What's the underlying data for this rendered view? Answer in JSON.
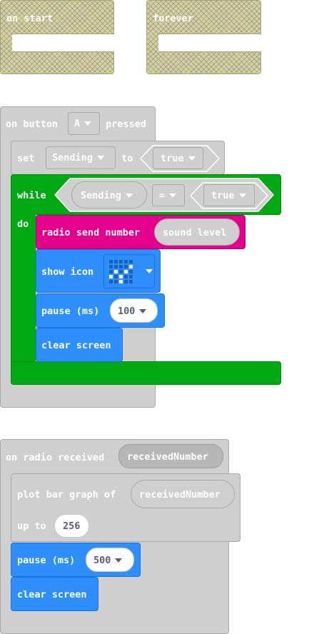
{
  "on_start": {
    "label": "on start"
  },
  "forever": {
    "label": "forever"
  },
  "button_event": {
    "prefix": "on button",
    "button": "A",
    "suffix": "pressed",
    "set": {
      "keyword": "set",
      "variable": "Sending",
      "to": "to",
      "value": "true"
    },
    "while": {
      "keyword": "while",
      "do": "do",
      "left": "Sending",
      "operator": "=",
      "right": "true"
    },
    "radio_send": {
      "label": "radio send number",
      "value": "sound level"
    },
    "show_icon": {
      "label": "show icon",
      "icon": "pixel-icon"
    },
    "pause": {
      "label": "pause (ms)",
      "value": "100"
    },
    "clear": {
      "label": "clear screen"
    }
  },
  "radio_event": {
    "label": "on radio received",
    "param": "receivedNumber",
    "plot": {
      "label": "plot bar graph of",
      "value": "receivedNumber",
      "upto_label": "up to",
      "upto_value": "256"
    },
    "pause": {
      "label": "pause (ms)",
      "value": "500"
    },
    "clear": {
      "label": "clear screen"
    }
  },
  "colors": {
    "event_gray": "#cfcfcf",
    "loops_green": "#00a811",
    "radio_pink": "#e3008c",
    "basic_blue": "#2e8ffc",
    "disabled_hatch": "#d9d48c"
  }
}
